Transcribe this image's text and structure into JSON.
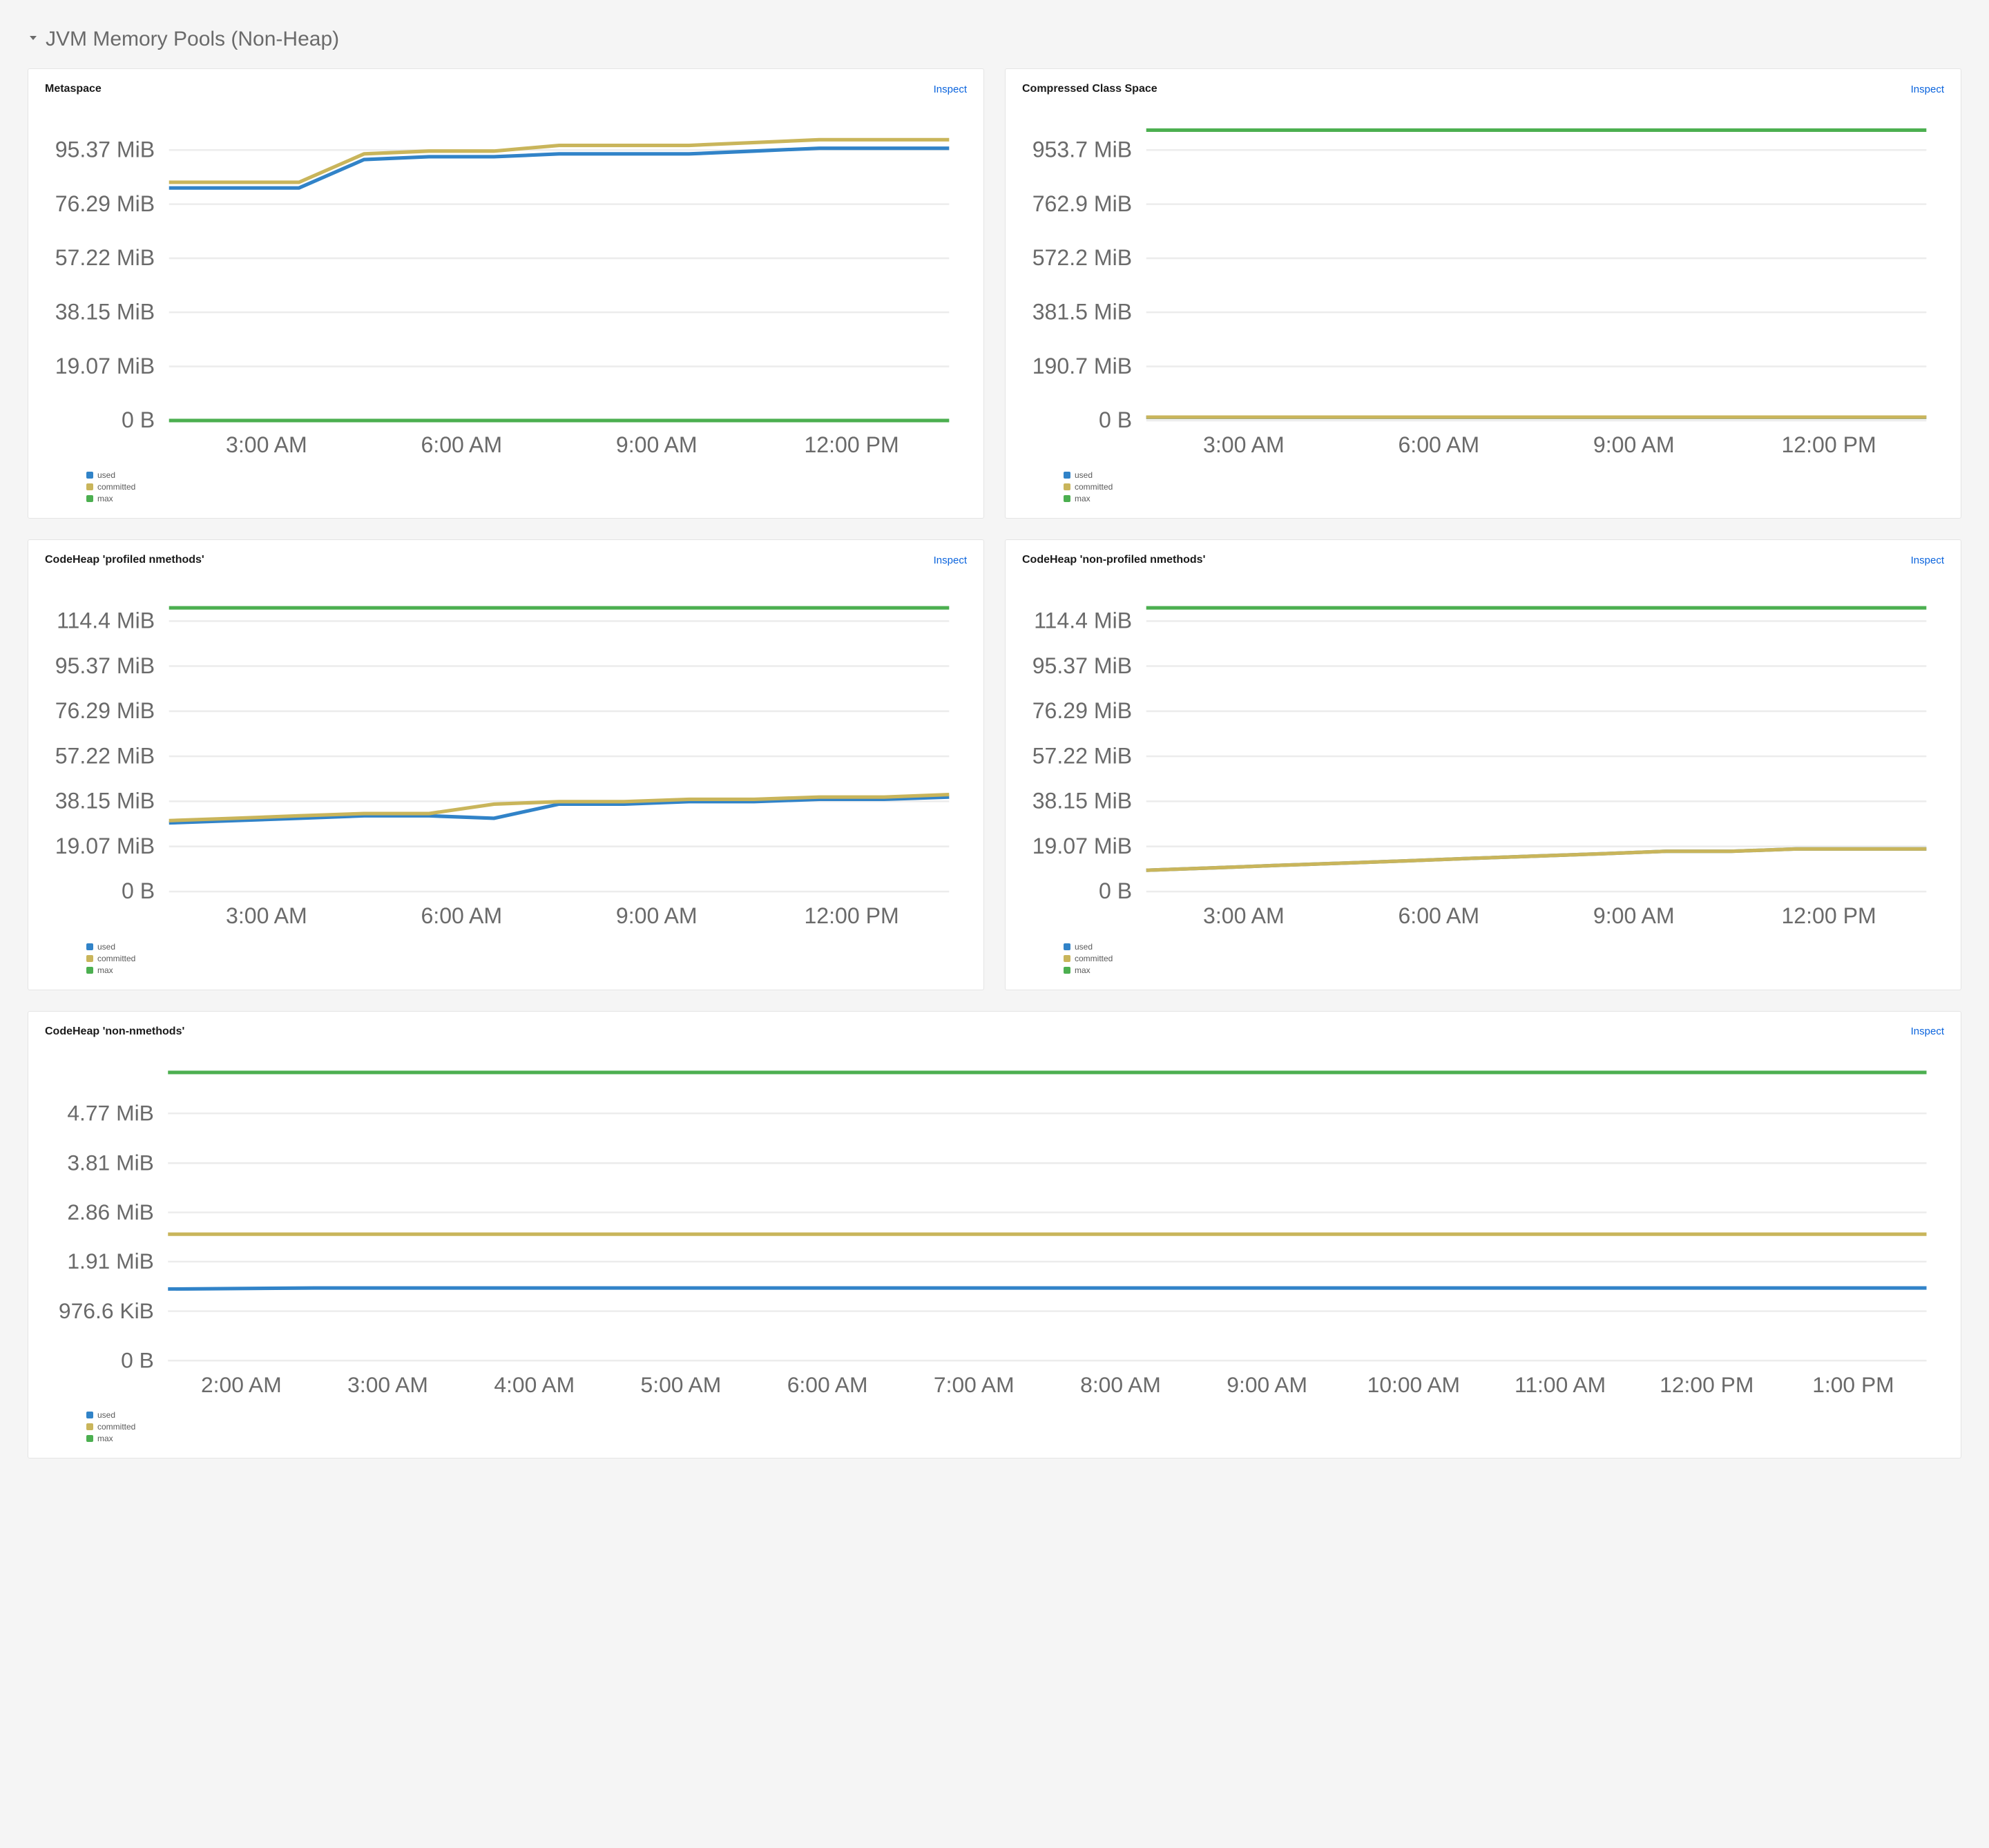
{
  "section_title": "JVM Memory Pools (Non-Heap)",
  "inspect_label": "Inspect",
  "legend": {
    "used": "used",
    "committed": "committed",
    "max": "max"
  },
  "colors": {
    "used": "#3183c8",
    "committed": "#c9b55b",
    "max": "#4caf50",
    "grid": "#ececec"
  },
  "panels": [
    {
      "id": "metaspace",
      "title": "Metaspace",
      "full": false
    },
    {
      "id": "ccs",
      "title": "Compressed Class Space",
      "full": false
    },
    {
      "id": "profiled",
      "title": "CodeHeap 'profiled nmethods'",
      "full": false
    },
    {
      "id": "nonprofiled",
      "title": "CodeHeap 'non-profiled nmethods'",
      "full": false
    },
    {
      "id": "nonnmethods",
      "title": "CodeHeap 'non-nmethods'",
      "full": true
    }
  ],
  "chart_data": [
    {
      "id": "metaspace",
      "type": "line",
      "title": "Metaspace",
      "xlabel": "",
      "ylabel": "",
      "y_ticks": [
        "0 B",
        "19.07 MiB",
        "38.15 MiB",
        "57.22 MiB",
        "76.29 MiB",
        "95.37 MiB"
      ],
      "y_values": [
        0,
        19.07,
        38.15,
        57.22,
        76.29,
        95.37
      ],
      "ylim": [
        0,
        105
      ],
      "x_ticks": [
        "3:00 AM",
        "6:00 AM",
        "9:00 AM",
        "12:00 PM"
      ],
      "x": [
        1,
        2,
        3,
        4,
        5,
        6,
        7,
        8,
        9,
        10,
        11,
        12,
        13
      ],
      "series": [
        {
          "name": "used",
          "values": [
            82,
            82,
            82,
            92,
            93,
            93,
            94,
            94,
            94,
            95,
            96,
            96,
            96
          ]
        },
        {
          "name": "committed",
          "values": [
            84,
            84,
            84,
            94,
            95,
            95,
            97,
            97,
            97,
            98,
            99,
            99,
            99
          ]
        },
        {
          "name": "max",
          "values": [
            0,
            0,
            0,
            0,
            0,
            0,
            0,
            0,
            0,
            0,
            0,
            0,
            0
          ]
        }
      ]
    },
    {
      "id": "ccs",
      "type": "line",
      "title": "Compressed Class Space",
      "y_ticks": [
        "0 B",
        "190.7 MiB",
        "381.5 MiB",
        "572.2 MiB",
        "762.9 MiB",
        "953.7 MiB"
      ],
      "y_values": [
        0,
        190.7,
        381.5,
        572.2,
        762.9,
        953.7
      ],
      "ylim": [
        0,
        1050
      ],
      "x_ticks": [
        "3:00 AM",
        "6:00 AM",
        "9:00 AM",
        "12:00 PM"
      ],
      "x": [
        1,
        2,
        3,
        4,
        5,
        6,
        7,
        8,
        9,
        10,
        11,
        12,
        13
      ],
      "series": [
        {
          "name": "used",
          "values": [
            11,
            11,
            11,
            11,
            11,
            11,
            11,
            11,
            11,
            11,
            11,
            11,
            11
          ]
        },
        {
          "name": "committed",
          "values": [
            12,
            12,
            12,
            12,
            12,
            12,
            12,
            12,
            12,
            12,
            12,
            12,
            12
          ]
        },
        {
          "name": "max",
          "values": [
            1024,
            1024,
            1024,
            1024,
            1024,
            1024,
            1024,
            1024,
            1024,
            1024,
            1024,
            1024,
            1024
          ]
        }
      ]
    },
    {
      "id": "profiled",
      "type": "line",
      "title": "CodeHeap 'profiled nmethods'",
      "y_ticks": [
        "0 B",
        "19.07 MiB",
        "38.15 MiB",
        "57.22 MiB",
        "76.29 MiB",
        "95.37 MiB",
        "114.4 MiB"
      ],
      "y_values": [
        0,
        19.07,
        38.15,
        57.22,
        76.29,
        95.37,
        114.4
      ],
      "ylim": [
        0,
        126
      ],
      "x_ticks": [
        "3:00 AM",
        "6:00 AM",
        "9:00 AM",
        "12:00 PM"
      ],
      "x": [
        1,
        2,
        3,
        4,
        5,
        6,
        7,
        8,
        9,
        10,
        11,
        12,
        13
      ],
      "series": [
        {
          "name": "used",
          "values": [
            29,
            30,
            31,
            32,
            32,
            31,
            37,
            37,
            38,
            38,
            39,
            39,
            40
          ]
        },
        {
          "name": "committed",
          "values": [
            30,
            31,
            32,
            33,
            33,
            37,
            38,
            38,
            39,
            39,
            40,
            40,
            41
          ]
        },
        {
          "name": "max",
          "values": [
            120,
            120,
            120,
            120,
            120,
            120,
            120,
            120,
            120,
            120,
            120,
            120,
            120
          ]
        }
      ]
    },
    {
      "id": "nonprofiled",
      "type": "line",
      "title": "CodeHeap 'non-profiled nmethods'",
      "y_ticks": [
        "0 B",
        "19.07 MiB",
        "38.15 MiB",
        "57.22 MiB",
        "76.29 MiB",
        "95.37 MiB",
        "114.4 MiB"
      ],
      "y_values": [
        0,
        19.07,
        38.15,
        57.22,
        76.29,
        95.37,
        114.4
      ],
      "ylim": [
        0,
        126
      ],
      "x_ticks": [
        "3:00 AM",
        "6:00 AM",
        "9:00 AM",
        "12:00 PM"
      ],
      "x": [
        1,
        2,
        3,
        4,
        5,
        6,
        7,
        8,
        9,
        10,
        11,
        12,
        13
      ],
      "series": [
        {
          "name": "used",
          "values": [
            9,
            10,
            11,
            12,
            13,
            14,
            15,
            16,
            17,
            17,
            18,
            18,
            18
          ]
        },
        {
          "name": "committed",
          "values": [
            9,
            10,
            11,
            12,
            13,
            14,
            15,
            16,
            17,
            17,
            18,
            18,
            18
          ]
        },
        {
          "name": "max",
          "values": [
            120,
            120,
            120,
            120,
            120,
            120,
            120,
            120,
            120,
            120,
            120,
            120,
            120
          ]
        }
      ]
    },
    {
      "id": "nonnmethods",
      "type": "line",
      "title": "CodeHeap 'non-nmethods'",
      "y_ticks": [
        "0 B",
        "976.6 KiB",
        "1.91 MiB",
        "2.86 MiB",
        "3.81 MiB",
        "4.77 MiB"
      ],
      "y_values": [
        0,
        0.954,
        1.91,
        2.86,
        3.81,
        4.77
      ],
      "ylim": [
        0,
        5.7
      ],
      "x_ticks": [
        "2:00 AM",
        "3:00 AM",
        "4:00 AM",
        "5:00 AM",
        "6:00 AM",
        "7:00 AM",
        "8:00 AM",
        "9:00 AM",
        "10:00 AM",
        "11:00 AM",
        "12:00 PM",
        "1:00 PM"
      ],
      "x": [
        1,
        2,
        3,
        4,
        5,
        6,
        7,
        8,
        9,
        10,
        11,
        12,
        13
      ],
      "series": [
        {
          "name": "used",
          "values": [
            1.38,
            1.4,
            1.4,
            1.4,
            1.4,
            1.4,
            1.4,
            1.4,
            1.4,
            1.4,
            1.4,
            1.4,
            1.4
          ]
        },
        {
          "name": "committed",
          "values": [
            2.44,
            2.44,
            2.44,
            2.44,
            2.44,
            2.44,
            2.44,
            2.44,
            2.44,
            2.44,
            2.44,
            2.44,
            2.44
          ]
        },
        {
          "name": "max",
          "values": [
            5.56,
            5.56,
            5.56,
            5.56,
            5.56,
            5.56,
            5.56,
            5.56,
            5.56,
            5.56,
            5.56,
            5.56,
            5.56
          ]
        }
      ]
    }
  ]
}
